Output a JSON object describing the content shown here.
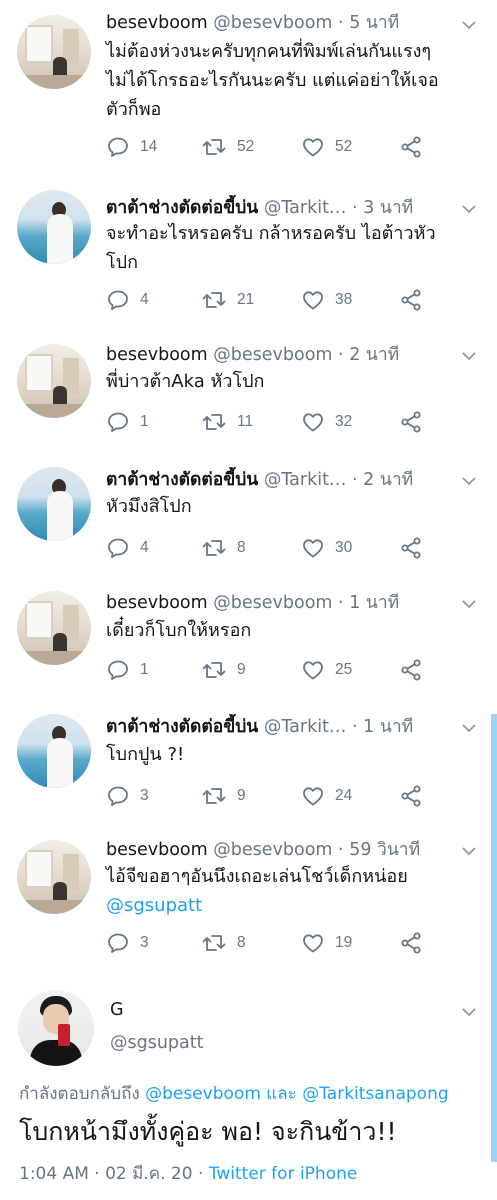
{
  "tweets": [
    {
      "name": "besevboom",
      "handle": "@besevboom",
      "dot": "·",
      "time": "5 นาที",
      "text_lines": [
        "ไม่ต้องห่วงนะครับทุกคนที่พิมพ์เล่นกันแรงๆ",
        "ไม่ได้โกรธอะไรกันนะครับ แต่แค่อย่าให้เจอ",
        "ตัวก็พอ"
      ],
      "replies": "14",
      "retweets": "52",
      "likes": "52"
    },
    {
      "name": "ตาต้าช่างตัดต่อขี้บ่น",
      "handle": "@Tarkit…",
      "dot": "·",
      "time": "3 นาที",
      "text_lines": [
        "จะทำอะไรหรอครับ กล้าหรอครับ ไอต้าวหัว",
        "โปก"
      ],
      "replies": "4",
      "retweets": "21",
      "likes": "38"
    },
    {
      "name": "besevboom",
      "handle": "@besevboom",
      "dot": "·",
      "time": "2 นาที",
      "text_lines": [
        "พี่บ่าวต้าAka หัวโปก"
      ],
      "replies": "1",
      "retweets": "11",
      "likes": "32"
    },
    {
      "name": "ตาต้าช่างตัดต่อขี้บ่น",
      "handle": "@Tarkit…",
      "dot": "·",
      "time": "2 นาที",
      "text_lines": [
        "หัวมึงสิโปก"
      ],
      "replies": "4",
      "retweets": "8",
      "likes": "30"
    },
    {
      "name": "besevboom",
      "handle": "@besevboom",
      "dot": "·",
      "time": "1 นาที",
      "text_lines": [
        "เดี๋ยวก็โบกให้หรอก"
      ],
      "replies": "1",
      "retweets": "9",
      "likes": "25"
    },
    {
      "name": "ตาต้าช่างตัดต่อขี้บ่น",
      "handle": "@Tarkit…",
      "dot": "·",
      "time": "1 นาที",
      "text_lines": [
        "โบกปูน ?!"
      ],
      "replies": "3",
      "retweets": "9",
      "likes": "24"
    },
    {
      "name": "besevboom",
      "handle": "@besevboom",
      "dot": "·",
      "time": "59 วินาที",
      "text_lines": [
        "ไอ้จีขอฮาๆอันนึงเถอะเล่นโชว์เด็กหน่อย"
      ],
      "mention": "@sgsupatt",
      "replies": "3",
      "retweets": "8",
      "likes": "19"
    }
  ],
  "focused": {
    "name": "G",
    "handle": "@sgsupatt",
    "replying_prefix": "กำลังตอบกลับถึง",
    "replying_to_1": "@besevboom",
    "replying_and": "และ",
    "replying_to_2": "@Tarkitsanapong",
    "text": "โบกหน้ามึงทั้งคู่อะ พอ! จะกินข้าว!!",
    "time": "1:04 AM",
    "date": "02 มี.ค. 20",
    "dot": "·",
    "source": "Twitter for iPhone"
  },
  "colors": {
    "link": "#1da1f2",
    "secondary": "#657786",
    "primary_text": "#14171a",
    "scrollbar": "#9ed3f3"
  },
  "icons": [
    "reply-icon",
    "retweet-icon",
    "like-icon",
    "share-icon",
    "chevron-down-icon"
  ]
}
